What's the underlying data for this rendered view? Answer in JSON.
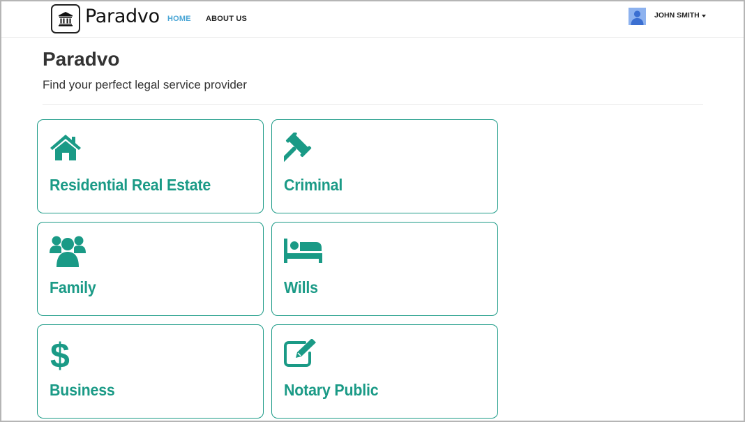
{
  "navbar": {
    "brand": "Paradvo",
    "links": [
      {
        "label": "HOME",
        "active": true
      },
      {
        "label": "ABOUT US",
        "active": false
      }
    ],
    "user": {
      "name": "JOHN SMITH"
    }
  },
  "header": {
    "title": "Paradvo",
    "subtitle": "Find your perfect legal service provider"
  },
  "categories": [
    {
      "label": "Residential Real Estate",
      "icon": "home-icon"
    },
    {
      "label": "Criminal",
      "icon": "gavel-icon"
    },
    {
      "label": "Family",
      "icon": "users-icon"
    },
    {
      "label": "Wills",
      "icon": "bed-icon"
    },
    {
      "label": "Business",
      "icon": "dollar-icon"
    },
    {
      "label": "Notary Public",
      "icon": "edit-icon"
    }
  ],
  "colors": {
    "accent": "#1a9a86",
    "nav_active": "#4aa6d6",
    "avatar_bg": "#8db2ef"
  }
}
